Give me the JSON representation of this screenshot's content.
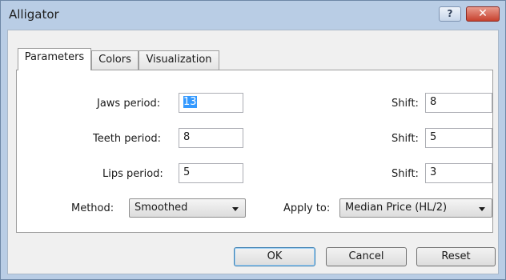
{
  "window": {
    "title": "Alligator",
    "help_label": "?",
    "close_label": "✕"
  },
  "tabs": [
    {
      "label": "Parameters",
      "active": true
    },
    {
      "label": "Colors",
      "active": false
    },
    {
      "label": "Visualization",
      "active": false
    }
  ],
  "params": {
    "jaws_label": "Jaws period:",
    "jaws_value": "13",
    "jaws_shift_label": "Shift:",
    "jaws_shift_value": "8",
    "teeth_label": "Teeth period:",
    "teeth_value": "8",
    "teeth_shift_label": "Shift:",
    "teeth_shift_value": "5",
    "lips_label": "Lips period:",
    "lips_value": "5",
    "lips_shift_label": "Shift:",
    "lips_shift_value": "3",
    "method_label": "Method:",
    "method_value": "Smoothed",
    "apply_label": "Apply to:",
    "apply_value": "Median Price (HL/2)"
  },
  "buttons": {
    "ok": "OK",
    "cancel": "Cancel",
    "reset": "Reset"
  },
  "colors": {
    "title_bar": "#b9cde5",
    "close_button": "#c7412e",
    "selection": "#3399ff"
  }
}
